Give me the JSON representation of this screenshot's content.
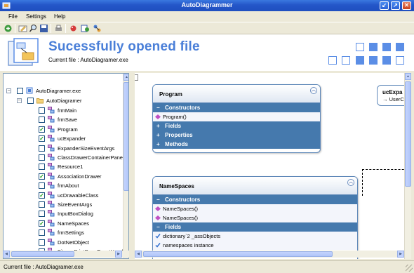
{
  "window": {
    "title": "AutoDiagrammer"
  },
  "menu": {
    "items": [
      "File",
      "Settings",
      "Help"
    ]
  },
  "toolbar": {
    "buttons": [
      "open-icon",
      "settings-icon",
      "search-icon",
      "save-icon",
      "print-icon",
      "bug-icon",
      "refresh-icon",
      "connect-icon"
    ]
  },
  "header": {
    "title": "Sucessfully opened file",
    "file_label": "Current file : AutoDiagramer.exe"
  },
  "tree": {
    "root": "AutoDiagramer.exe",
    "namespace": "AutoDiagramer",
    "items": [
      {
        "label": "frmMain",
        "checked": false
      },
      {
        "label": "frmSave",
        "checked": false
      },
      {
        "label": "Program",
        "checked": true
      },
      {
        "label": "ucExpander",
        "checked": true
      },
      {
        "label": "ExpanderSizeEventArgs",
        "checked": false
      },
      {
        "label": "ClassDrawerContainerPanel",
        "checked": false
      },
      {
        "label": "Resource1",
        "checked": false
      },
      {
        "label": "AssociationDrawer",
        "checked": true
      },
      {
        "label": "frmAbout",
        "checked": false
      },
      {
        "label": "ucDrawableClass",
        "checked": true
      },
      {
        "label": "SizeEventArgs",
        "checked": false
      },
      {
        "label": "InputBoxDialog",
        "checked": false
      },
      {
        "label": "NameSpaces",
        "checked": true
      },
      {
        "label": "frmSettings",
        "checked": false
      },
      {
        "label": "DotNetObject",
        "checked": false
      },
      {
        "label": "BitmapPrintPageEventHandler",
        "checked": false
      }
    ]
  },
  "diagram": {
    "program": {
      "title": "Program",
      "sections": [
        {
          "title": "Constructors",
          "expanded": true,
          "members": [
            "Program()"
          ]
        },
        {
          "title": "Fields",
          "expanded": false,
          "members": []
        },
        {
          "title": "Properties",
          "expanded": false,
          "members": []
        },
        {
          "title": "Methods",
          "expanded": false,
          "members": []
        }
      ]
    },
    "namespaces": {
      "title": "NameSpaces",
      "sections": [
        {
          "title": "Constructors",
          "expanded": true,
          "members": [
            "NameSpaces()",
            "NameSpaces()"
          ]
        },
        {
          "title": "Fields",
          "expanded": true,
          "members": [
            "dictionary`2 _assObjects",
            "namespaces instance"
          ]
        }
      ]
    },
    "ucexpander": {
      "title": "ucExpa",
      "sub": "→ UserC"
    }
  },
  "status": {
    "text": "Current file : AutoDiagramer.exe"
  },
  "colors": {
    "accent": "#4a7fd8",
    "section": "#4579ad",
    "check": "#21a121"
  }
}
